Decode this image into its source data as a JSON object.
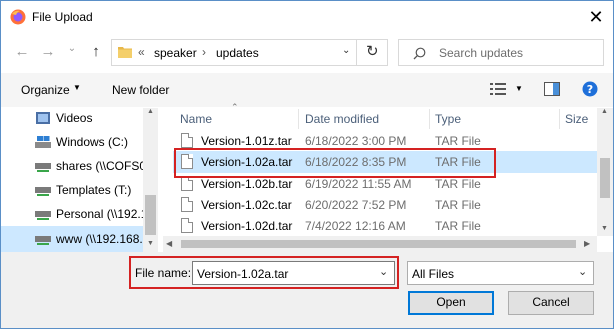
{
  "window": {
    "title": "File Upload",
    "close_glyph": "✕"
  },
  "address": {
    "overflow": "«",
    "path": [
      "speaker",
      "updates"
    ],
    "separator": "›"
  },
  "search": {
    "placeholder": "Search updates"
  },
  "toolbar": {
    "organize_label": "Organize",
    "new_folder_label": "New folder"
  },
  "sidebar": {
    "items": [
      {
        "label": "Videos",
        "icon": "videos-icon"
      },
      {
        "label": "Windows (C:)",
        "icon": "drive-icon"
      },
      {
        "label": "shares (\\\\COFS0",
        "icon": "network-drive-icon"
      },
      {
        "label": "Templates (T:)",
        "icon": "network-drive-icon"
      },
      {
        "label": "Personal (\\\\192.1",
        "icon": "network-drive-icon"
      },
      {
        "label": "www (\\\\192.168.",
        "icon": "network-drive-icon",
        "selected": true
      }
    ]
  },
  "file_list": {
    "columns": [
      "Name",
      "Date modified",
      "Type",
      "Size"
    ],
    "rows": [
      {
        "name": "Version-1.01z.tar",
        "date": "6/18/2022 3:00 PM",
        "type": "TAR File",
        "selected": false
      },
      {
        "name": "Version-1.02a.tar",
        "date": "6/18/2022 8:35 PM",
        "type": "TAR File",
        "selected": true
      },
      {
        "name": "Version-1.02b.tar",
        "date": "6/19/2022 11:55 AM",
        "type": "TAR File",
        "selected": false
      },
      {
        "name": "Version-1.02c.tar",
        "date": "6/20/2022 7:52 PM",
        "type": "TAR File",
        "selected": false
      },
      {
        "name": "Version-1.02d.tar",
        "date": "7/4/2022 12:16 AM",
        "type": "TAR File",
        "selected": false
      }
    ]
  },
  "footer": {
    "filename_label": "File name:",
    "filename_value": "Version-1.02a.tar",
    "filter_value": "All Files",
    "open_label": "Open",
    "cancel_label": "Cancel"
  },
  "colors": {
    "highlight_red": "#d42222",
    "selection_blue": "#cce8ff",
    "accent_blue": "#0078d7"
  }
}
